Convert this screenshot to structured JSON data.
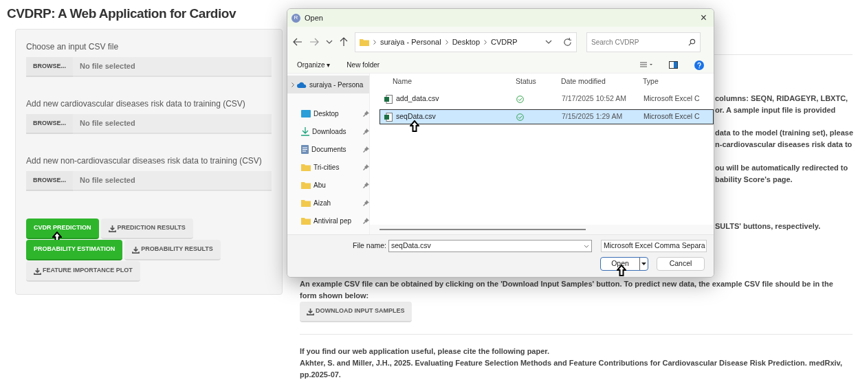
{
  "page_title": "CVDRP: A Web Application for Cardiov",
  "inputs": [
    {
      "label": "Choose an input CSV file",
      "button": "BROWSE...",
      "value": "No file selected"
    },
    {
      "label": "Add new cardiovascular diseases risk data to training (CSV)",
      "button": "BROWSE...",
      "value": "No file selected"
    },
    {
      "label": "Add new non-cardiovascular diseases risk data to training (CSV)",
      "button": "BROWSE...",
      "value": "No file selected"
    }
  ],
  "action_rows": [
    [
      {
        "label": "CVDR PREDICTION",
        "kind": "primary"
      },
      {
        "label": "PREDICTION RESULTS",
        "kind": "download"
      }
    ],
    [
      {
        "label": "PROBABILITY ESTIMATION",
        "kind": "primary"
      },
      {
        "label": "PROBABILITY RESULTS",
        "kind": "download"
      }
    ],
    [
      {
        "label": "FEATURE IMPORTANCE PLOT",
        "kind": "download"
      }
    ]
  ],
  "partial_text": [
    {
      "lines": [
        "columns: SEQN, RIDAGEYR, LBXTC,",
        "or. A sample input file is provided"
      ]
    },
    {
      "lines": [
        "data to the model (training set), please",
        "n-cardiovascular diseases risk data to"
      ]
    },
    {
      "lines": [
        "ou will be automatically redirected to",
        "bability Score's page."
      ]
    },
    {
      "lines": [
        "SULTS' buttons, respectively."
      ]
    }
  ],
  "example_text": "An example CSV file can be obtained by clicking on the 'Download Input Samples' button. To predict new data, the example CSV file should be in the form shown below:",
  "download_button": "DOWNLOAD INPUT SAMPLES",
  "citation": [
    "If you find our web application useful, please cite the following paper.",
    "Akhter, S. and Miller, J.H., 2025. Evaluating Feature Selection Methods and Feature Contributions for Cardiovascular Disease Risk Prediction. medRxiv, pp.2025-07."
  ],
  "dialog": {
    "title": "Open",
    "app_icon": "R",
    "close": "×",
    "path": [
      "suraiya - Personal",
      "Desktop",
      "CVDRP"
    ],
    "search_placeholder": "Search CVDRP",
    "toolbar": [
      "Organize ▾",
      "New folder"
    ],
    "nav": [
      {
        "label": "suraiya - Persona",
        "kind": "cloud",
        "pinned": false,
        "selected": true
      },
      {
        "label": "Desktop",
        "kind": "desktop",
        "pinned": true,
        "selected": false
      },
      {
        "label": "Downloads",
        "kind": "downloads",
        "pinned": true,
        "selected": false
      },
      {
        "label": "Documents",
        "kind": "documents",
        "pinned": true,
        "selected": false
      },
      {
        "label": "Tri-cities",
        "kind": "folder",
        "pinned": true,
        "selected": false
      },
      {
        "label": "Abu",
        "kind": "folder",
        "pinned": true,
        "selected": false
      },
      {
        "label": "Aizah",
        "kind": "folder",
        "pinned": true,
        "selected": false
      },
      {
        "label": "Antiviral pep",
        "kind": "folder",
        "pinned": true,
        "selected": false
      }
    ],
    "columns": [
      "Name",
      "Status",
      "Date modified",
      "Type"
    ],
    "files": [
      {
        "name": "add_data.csv",
        "synced": true,
        "date": "7/17/2025 10:52 AM",
        "type": "Microsoft Excel C",
        "selected": false
      },
      {
        "name": "seqData.csv",
        "synced": true,
        "date": "7/15/2025 1:29 AM",
        "type": "Microsoft Excel C",
        "selected": true
      }
    ],
    "file_name_label": "File name:",
    "file_name": "seqData.csv",
    "file_type": "Microsoft Excel Comma Separa",
    "open_button": "Open",
    "cancel_button": "Cancel"
  }
}
